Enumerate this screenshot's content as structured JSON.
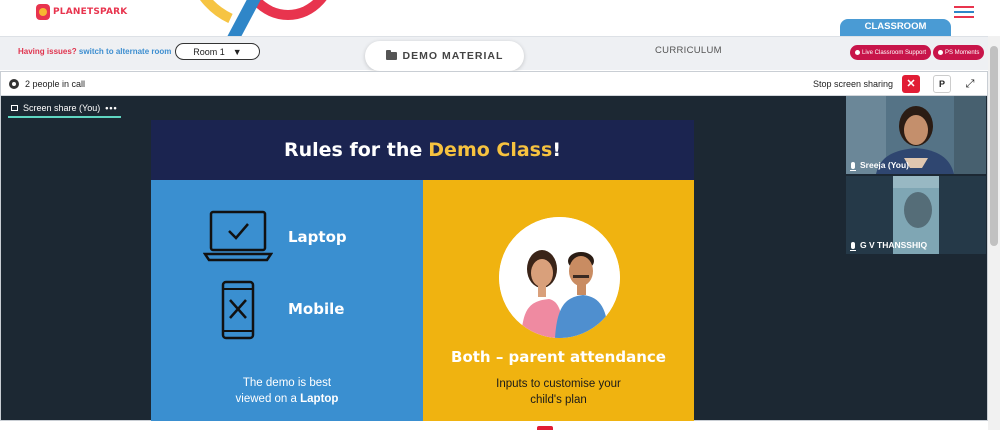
{
  "brand": {
    "logo_text": "PLANETSPARK"
  },
  "header": {
    "classroom_tab": "CLASSROOM"
  },
  "toolbar": {
    "issues_prefix": "Having issues?",
    "issues_link": "switch to alternate room",
    "room_select_value": "Room 1",
    "demo_material": "DEMO MATERIAL",
    "curriculum": "CURRICULUM",
    "live_support": "Live Classroom Support",
    "ps_moments": "PS Moments"
  },
  "call": {
    "people_count": "2 people in call",
    "stop_sharing": "Stop screen sharing",
    "close_symbol": "✕",
    "p_button": "P",
    "expand_symbol": "⤢",
    "screen_share_tab": "Screen share (You)",
    "tab_menu": "•••"
  },
  "slide": {
    "title_part1": "Rules for the",
    "title_accent": "Demo Class",
    "title_end": "!",
    "laptop_label": "Laptop",
    "mobile_label": "Mobile",
    "best_line1": "The demo is best",
    "best_line2_prefix": "viewed on a",
    "best_line2_bold": "Laptop",
    "both_label": "Both – parent attendance",
    "inputs_line1": "Inputs to customise your",
    "inputs_line2": "child's plan"
  },
  "participants": [
    {
      "name": "Sreeja (You)"
    },
    {
      "name": "G V THANSSHIQ"
    }
  ],
  "colors": {
    "brand_red": "#e8344e",
    "brand_blue": "#2f86c8",
    "slide_navy": "#1b2450",
    "slide_blue": "#3a8fd0",
    "slide_yellow": "#f0b310",
    "accent_yellow": "#f6c23f",
    "pill_magenta": "#c8154a"
  }
}
